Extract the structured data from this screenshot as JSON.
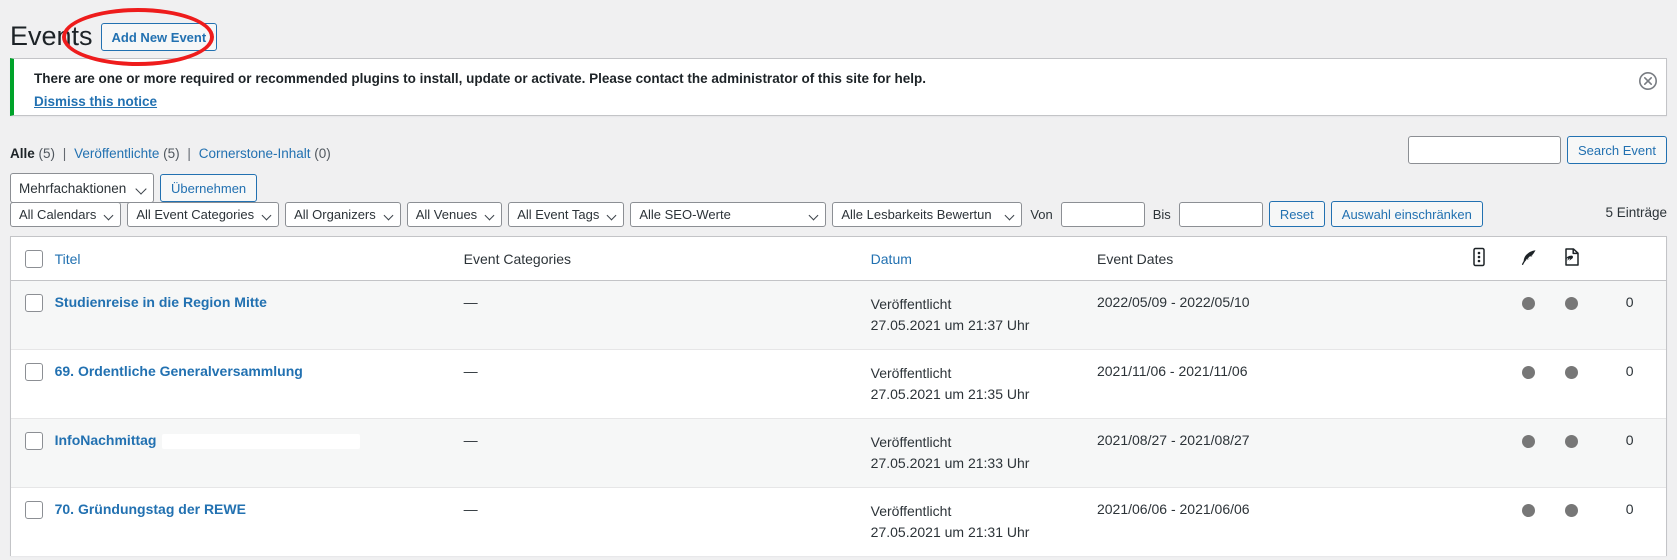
{
  "header": {
    "title": "Events",
    "add_new_button": "Add New Event"
  },
  "notice": {
    "message": "There are one or more required or recommended plugins to install, update or activate. Please contact the administrator of this site for help.",
    "dismiss_link": "Dismiss this notice",
    "close_icon": "close-icon",
    "accent_color": "#00a32a"
  },
  "views": {
    "all_label": "Alle",
    "all_count": "(5)",
    "published_label": "Veröffentlichte",
    "published_count": "(5)",
    "cornerstone_label": "Cornerstone-Inhalt",
    "cornerstone_count": "(0)",
    "separator": "|"
  },
  "search": {
    "value": "",
    "placeholder": "",
    "button_label": "Search Event"
  },
  "bulk": {
    "selected": "Mehrfachaktionen",
    "apply_label": "Übernehmen"
  },
  "filters": {
    "calendars": "All Calendars",
    "event_categories": "All Event Categories",
    "organizers": "All Organizers",
    "venues": "All Venues",
    "event_tags": "All Event Tags",
    "seo_values": "Alle SEO-Werte",
    "readability": "Alle Lesbarkeits Bewertun",
    "from_label": "Von",
    "from_value": "",
    "to_label": "Bis",
    "to_value": "",
    "reset_label": "Reset",
    "narrow_label": "Auswahl einschränken",
    "entries_count": "5 Einträge"
  },
  "table": {
    "columns": {
      "title": "Titel",
      "event_categories": "Event Categories",
      "date": "Datum",
      "event_dates": "Event Dates",
      "icon_columns": [
        "column-options-icon",
        "seo-feather-icon",
        "readability-page-icon"
      ]
    },
    "rows": [
      {
        "title": "Studienreise in die Region Mitte",
        "categories": "—",
        "status": "Veröffentlicht",
        "status_date": "27.05.2021 um 21:37 Uhr",
        "event_dates": "2022/05/09 - 2022/05/10",
        "seo_score": "dot",
        "readability_score": "dot",
        "links": "0",
        "redacted": false
      },
      {
        "title": "69. Ordentliche Generalversammlung",
        "categories": "—",
        "status": "Veröffentlicht",
        "status_date": "27.05.2021 um 21:35 Uhr",
        "event_dates": "2021/11/06 - 2021/11/06",
        "seo_score": "dot",
        "readability_score": "dot",
        "links": "0",
        "redacted": false
      },
      {
        "title": "InfoNachmittag",
        "categories": "—",
        "status": "Veröffentlicht",
        "status_date": "27.05.2021 um 21:33 Uhr",
        "event_dates": "2021/08/27 - 2021/08/27",
        "seo_score": "dot",
        "readability_score": "dot",
        "links": "0",
        "redacted": true
      },
      {
        "title": "70. Gründungstag der REWE",
        "categories": "—",
        "status": "Veröffentlicht",
        "status_date": "27.05.2021 um 21:31 Uhr",
        "event_dates": "2021/06/06 - 2021/06/06",
        "seo_score": "dot",
        "readability_score": "dot",
        "links": "0",
        "redacted": false
      }
    ]
  },
  "annotation": {
    "shape": "ellipse-highlight",
    "color": "#ee1c1c"
  }
}
